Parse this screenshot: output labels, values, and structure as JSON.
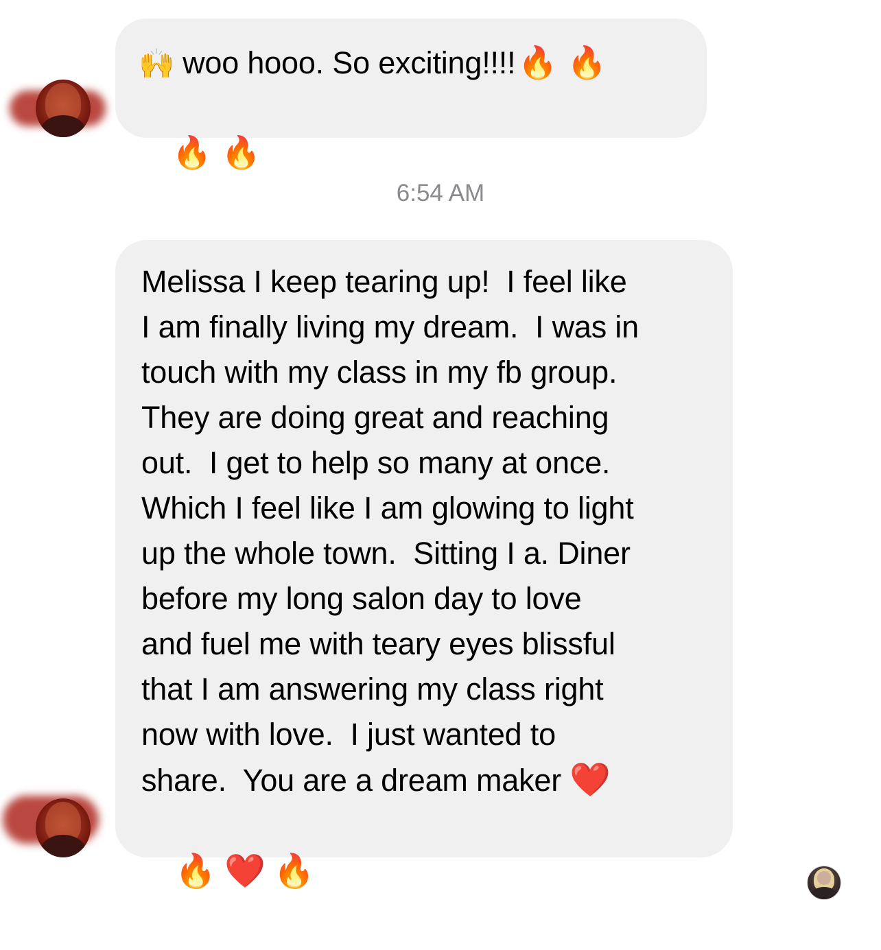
{
  "messages": [
    {
      "emoji_prefix": "🙌",
      "text": "woo hooo.  So exciting!!!!",
      "emoji_suffix_line1": "🔥🔥",
      "emoji_line2": "🔥🔥"
    },
    {
      "text": "Melissa I keep tearing up!  I feel like\nI am finally living my dream.  I was in\ntouch with my class in my fb group.\nThey are doing great and reaching\nout.  I get to help so many at once.\nWhich I feel like I am glowing to light\nup the whole town.  Sitting I a. Diner\nbefore my long salon day to love\nand fuel me with teary eyes blissful\nthat I am answering my class right\nnow with love.  I just wanted to\nshare.  You are a dream maker ",
      "emoji_end_line1": "❤️",
      "emoji_line_last": "🔥❤️🔥"
    }
  ],
  "timestamp": "6:54 AM",
  "colors": {
    "bubble_bg": "#f0f0f0",
    "timestamp_text": "#8a8a8e",
    "redaction": "#a5140a"
  }
}
